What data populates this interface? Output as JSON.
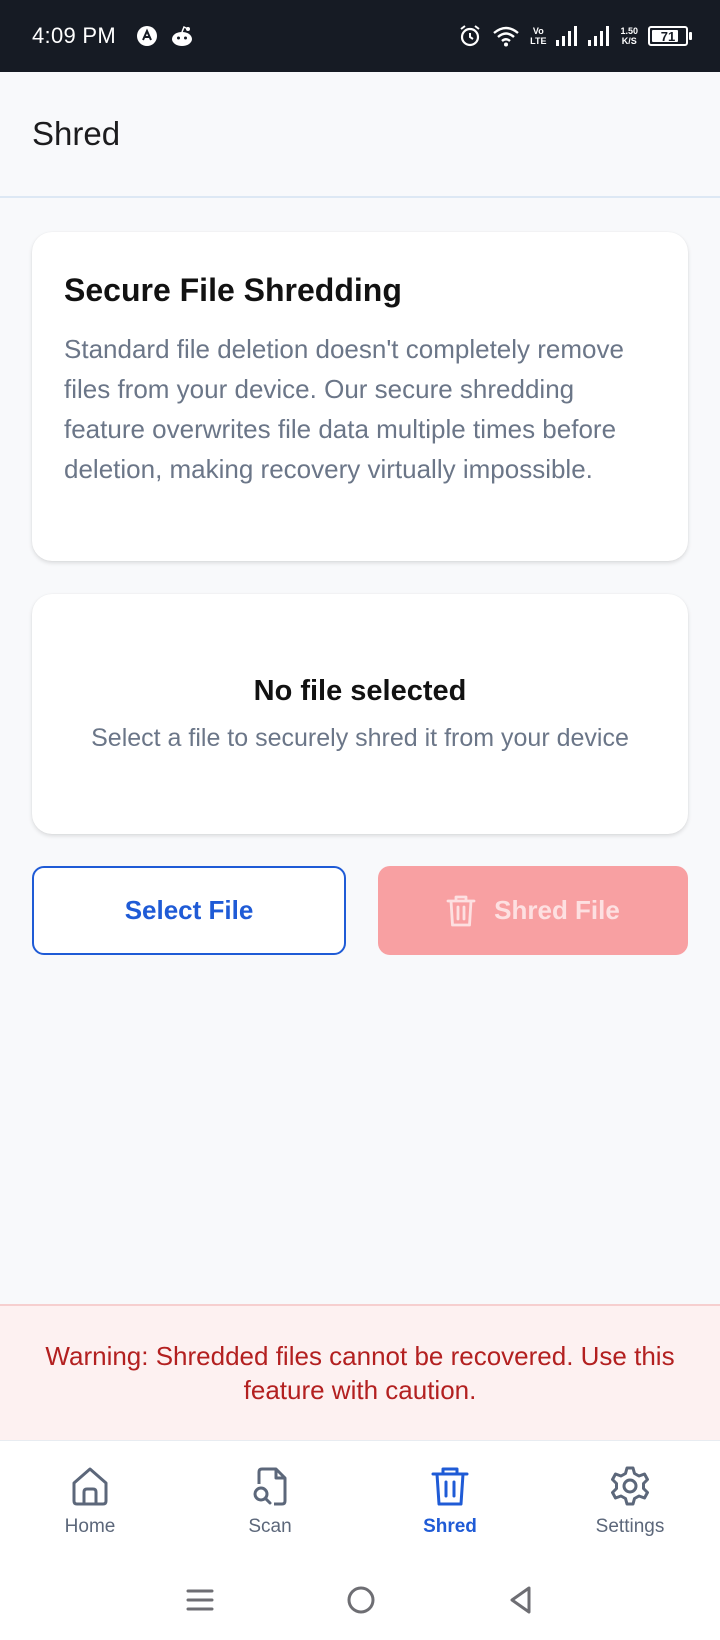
{
  "status_bar": {
    "time": "4:09 PM",
    "network_type": "Vo\nLTE",
    "speed": "1.50\nK/S",
    "battery": "71"
  },
  "header": {
    "title": "Shred"
  },
  "info_card": {
    "title": "Secure File Shredding",
    "body": "Standard file deletion doesn't completely remove files from your device. Our secure shredding feature overwrites file data multiple times before deletion, making recovery virtually impossible."
  },
  "file_card": {
    "title": "No file selected",
    "subtitle": "Select a file to securely shred it from your device"
  },
  "actions": {
    "select_label": "Select File",
    "shred_label": "Shred File"
  },
  "warning": {
    "text": "Warning: Shredded files cannot be recovered. Use this feature with caution."
  },
  "bottom_nav": {
    "items": [
      {
        "label": "Home",
        "icon": "home-icon"
      },
      {
        "label": "Scan",
        "icon": "scan-file-icon"
      },
      {
        "label": "Shred",
        "icon": "trash-icon",
        "active": true
      },
      {
        "label": "Settings",
        "icon": "gear-icon"
      }
    ]
  },
  "colors": {
    "primary": "#1f5bd6",
    "danger_disabled": "#f8a0a2",
    "warning_text": "#b32020",
    "warning_bg": "#fdf1f1",
    "status_bar_bg": "#161b24"
  }
}
